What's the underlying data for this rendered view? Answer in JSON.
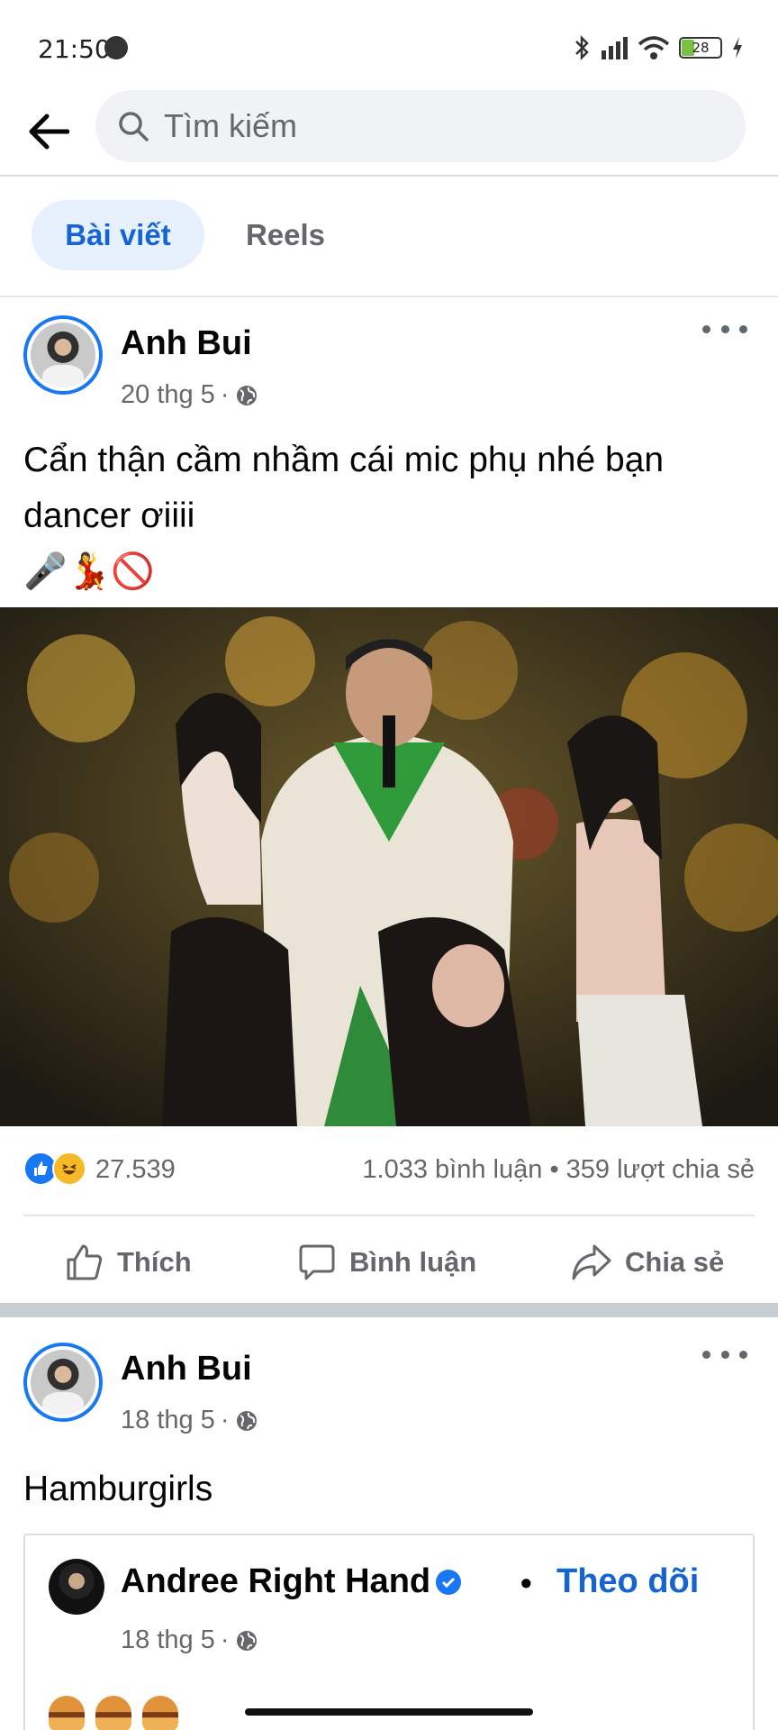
{
  "status_bar": {
    "time": "21:50",
    "battery": "28"
  },
  "search": {
    "placeholder": "Tìm kiếm"
  },
  "tabs": [
    {
      "label": "Bài viết",
      "selected": true
    },
    {
      "label": "Reels",
      "selected": false
    }
  ],
  "posts": [
    {
      "author": "Anh Bui",
      "date": "20 thg 5",
      "separator": "·",
      "text_line1": "Cẩn thận cầm nhầm cái mic phụ nhé bạn",
      "text_line2": "dancer ơiiii",
      "emojis": "🎤💃🚫",
      "reaction_count": "27.539",
      "comments": "1.033 bình luận",
      "bullet": "•",
      "shares": "359 lượt chia sẻ",
      "actions": {
        "like": "Thích",
        "comment": "Bình luận",
        "share": "Chia sẻ"
      }
    },
    {
      "author": "Anh Bui",
      "date": "18 thg 5",
      "separator": "·",
      "text": "Hamburgirls",
      "shared": {
        "author": "Andree Right Hand",
        "bullet": "•",
        "follow": "Theo dõi",
        "date": "18 thg 5",
        "separator": "·"
      }
    }
  ],
  "colors": {
    "accent": "#1877f2",
    "link": "#1664d1",
    "secondary_text": "#65676b",
    "tab_selected_bg": "#e7f0fd"
  },
  "icons": [
    "back-arrow-icon",
    "search-icon",
    "globe-icon",
    "more-icon",
    "like-icon",
    "comment-icon",
    "share-icon",
    "verified-icon"
  ]
}
